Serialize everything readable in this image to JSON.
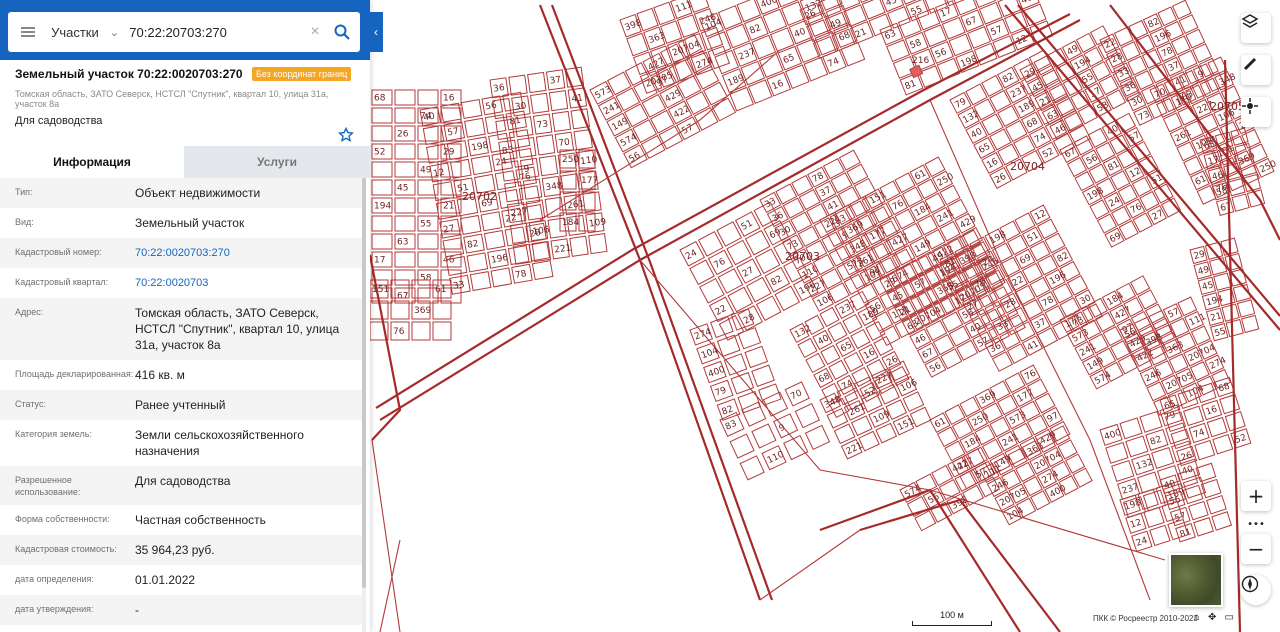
{
  "search": {
    "type_label": "Участки",
    "query": "70:22:20703:270"
  },
  "object": {
    "title": "Земельный участок 70:22:0020703:270",
    "badge": "Без координат границ",
    "address": "Томская область, ЗАТО Северск, НСТСЛ \"Спутник\", квартал 10, улица 31а, участок 8а",
    "purpose": "Для садоводства"
  },
  "tabs": [
    {
      "label": "Информация",
      "active": true
    },
    {
      "label": "Услуги",
      "active": false
    }
  ],
  "info_rows": [
    {
      "label": "Тип:",
      "value": "Объект недвижимости",
      "link": false
    },
    {
      "label": "Вид:",
      "value": "Земельный участок",
      "link": false
    },
    {
      "label": "Кадастровый номер:",
      "value": "70:22:0020703:270",
      "link": true
    },
    {
      "label": "Кадастровый квартал:",
      "value": "70:22:0020703",
      "link": true
    },
    {
      "label": "Адрес:",
      "value": "Томская область, ЗАТО Северск, НСТСЛ \"Спутник\", квартал 10, улица 31а, участок 8а",
      "link": false
    },
    {
      "label": "Площадь декларированная:",
      "value": "416 кв. м",
      "link": false
    },
    {
      "label": "Статус:",
      "value": "Ранее учтенный",
      "link": false
    },
    {
      "label": "Категория земель:",
      "value": "Земли сельскохозяйственного назначения",
      "link": false
    },
    {
      "label": "Разрешенное использование:",
      "value": "Для садоводства",
      "link": false
    },
    {
      "label": "Форма собственности:",
      "value": "Частная собственность",
      "link": false
    },
    {
      "label": "Кадастровая стоимость:",
      "value": "35 964,23 руб.",
      "link": false
    },
    {
      "label": "дата определения:",
      "value": "01.01.2022",
      "link": false
    },
    {
      "label": "дата утверждения:",
      "value": "-",
      "link": false
    }
  ],
  "map": {
    "quarter_labels": [
      "20702",
      "20703",
      "20704",
      "20705"
    ],
    "parcel_numbers": [
      "68",
      "16",
      "74",
      "26",
      "52",
      "29",
      "49",
      "45",
      "194",
      "21",
      "55",
      "63",
      "17",
      "46",
      "58",
      "67",
      "40",
      "56",
      "57",
      "81",
      "198",
      "12",
      "24",
      "51",
      "76",
      "69",
      "27",
      "22",
      "82",
      "28",
      "196",
      "33",
      "78",
      "36",
      "37",
      "30",
      "41",
      "73",
      "83",
      "70",
      "9",
      "110",
      "348",
      "227",
      "261",
      "106",
      "109",
      "221",
      "151",
      "61",
      "369",
      "76",
      "250",
      "177",
      "184",
      "573",
      "427",
      "241",
      "97",
      "149",
      "429",
      "574",
      "422",
      "56",
      "57",
      "398",
      "111",
      "363",
      "246",
      "20704",
      "20705",
      "274",
      "104",
      "400",
      "79",
      "82",
      "132",
      "237",
      "40",
      "189",
      "65"
    ],
    "highlight_parcel": "216",
    "scale_label": "100 м",
    "copyright": "ПКК © Росреестр 2010-2023"
  },
  "controls": {
    "layers_icon": "layers-icon",
    "ruler_icon": "ruler-icon",
    "locate_icon": "locate-icon",
    "zoom_in": "+",
    "zoom_out": "−",
    "more": "•••"
  }
}
